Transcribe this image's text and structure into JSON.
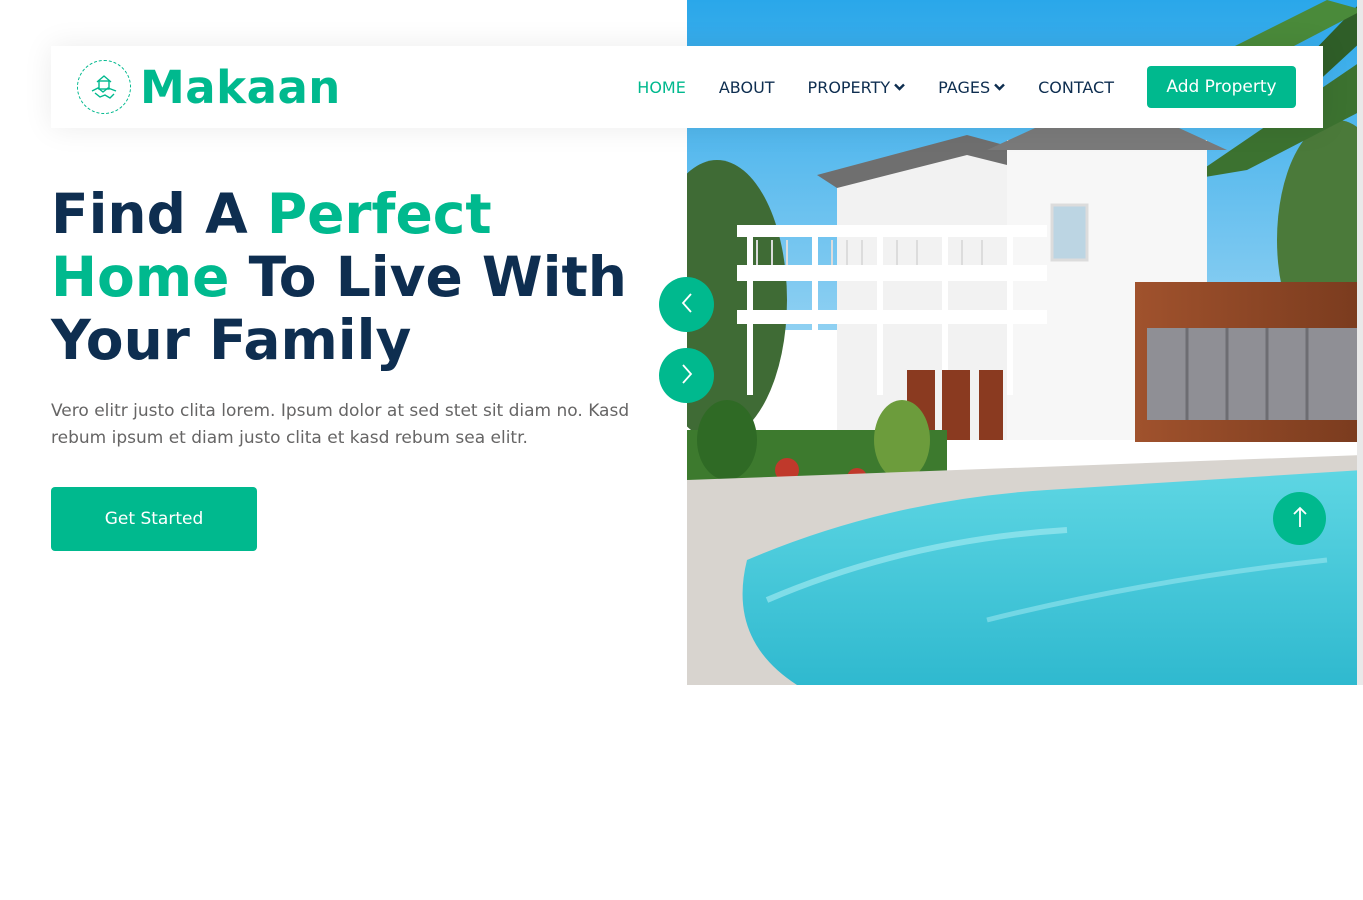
{
  "brand": {
    "name": "Makaan",
    "icon": "handshake-house-icon",
    "accent_color": "#00b98e",
    "dark_color": "#0e2e50"
  },
  "nav": {
    "items": [
      {
        "label": "HOME",
        "active": true
      },
      {
        "label": "ABOUT",
        "active": false
      },
      {
        "label": "PROPERTY",
        "active": false,
        "dropdown": true
      },
      {
        "label": "PAGES",
        "active": false,
        "dropdown": true
      },
      {
        "label": "CONTACT",
        "active": false
      }
    ],
    "cta_label": "Add Property"
  },
  "hero": {
    "heading_part1": "Find A ",
    "heading_accent": "Perfect Home",
    "heading_part2": " To Live With Your Family",
    "description": "Vero elitr justo clita lorem. Ipsum dolor at sed stet sit diam no. Kasd rebum ipsum et diam justo clita et kasd rebum sea elitr.",
    "cta_label": "Get Started",
    "image": "white-house-with-pool-photo"
  },
  "carousel": {
    "prev_icon": "chevron-left-icon",
    "next_icon": "chevron-right-icon"
  },
  "back_to_top": {
    "icon": "arrow-up-icon"
  }
}
